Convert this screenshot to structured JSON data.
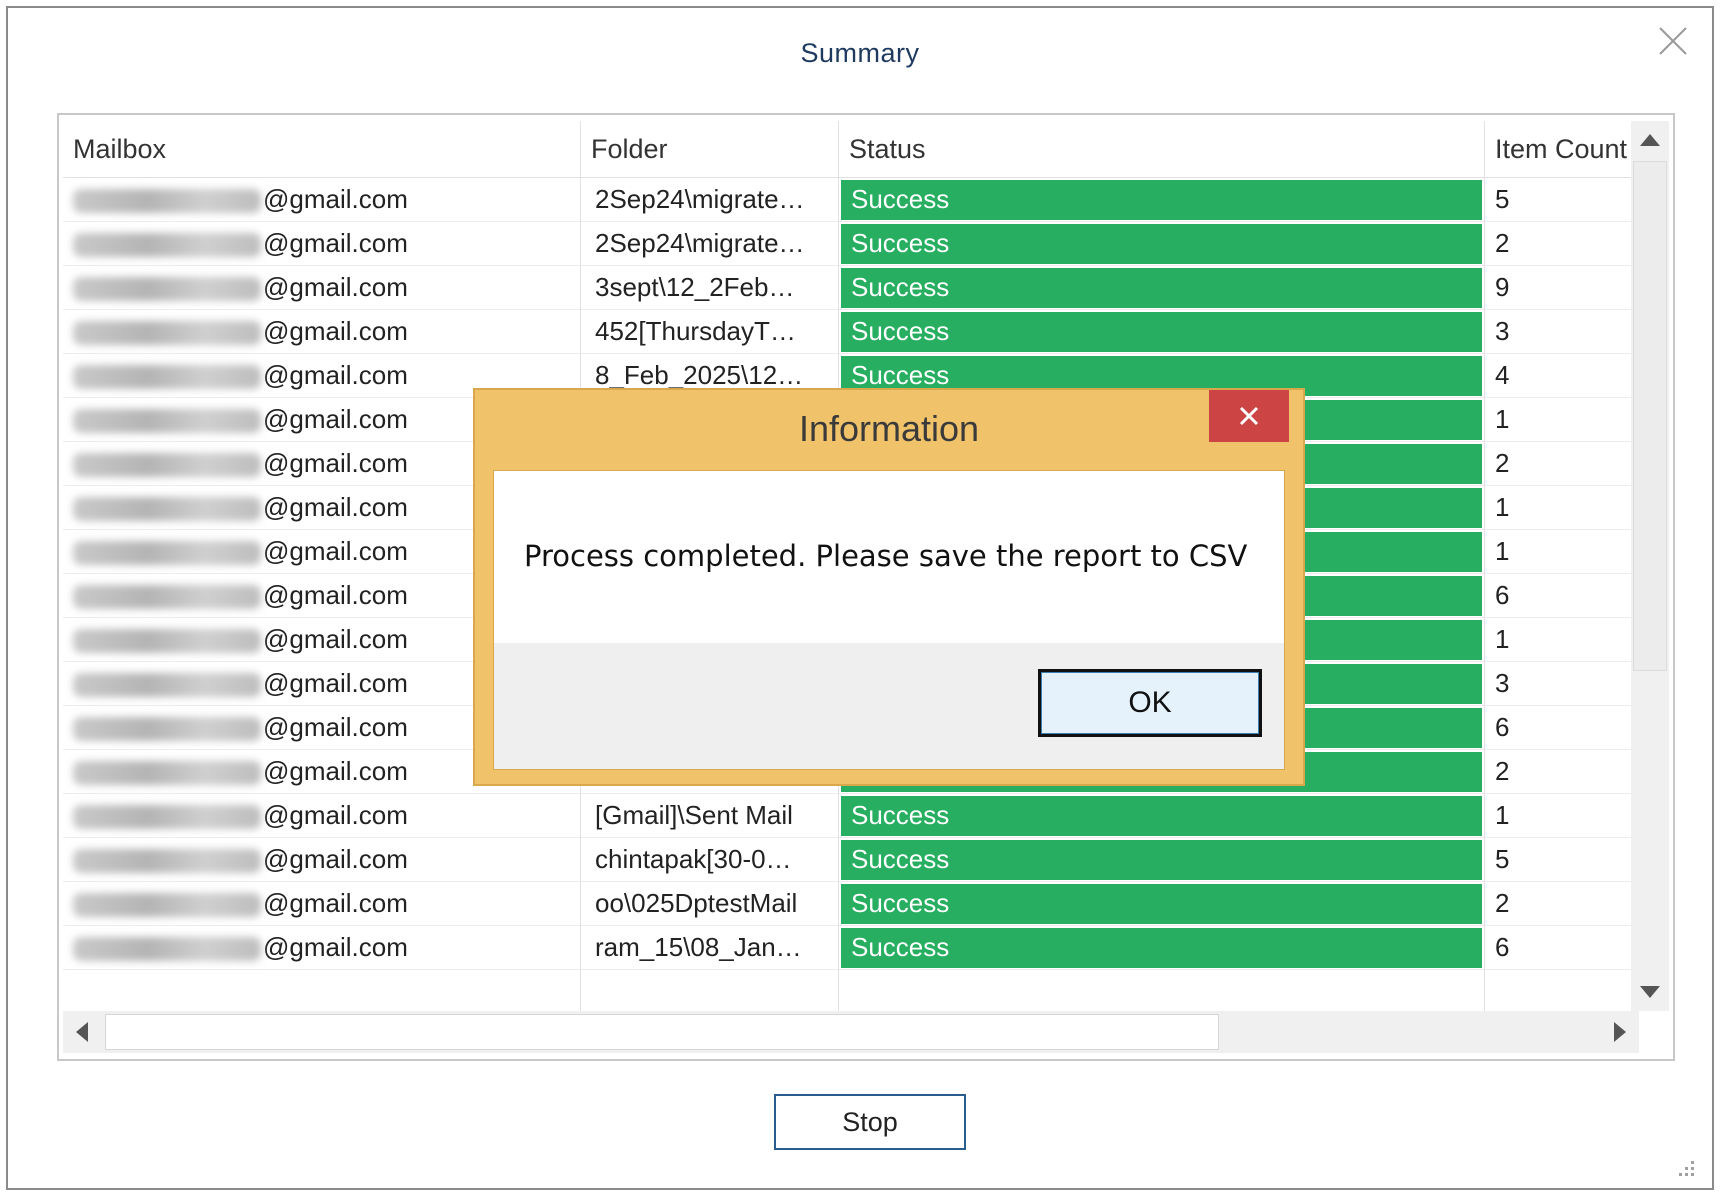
{
  "window": {
    "title": "Summary"
  },
  "grid": {
    "columns": [
      "Mailbox",
      "Folder",
      "Status",
      "Item Count"
    ],
    "rows": [
      {
        "mailbox": "@gmail.com",
        "folder": "2Sep24\\migrate…",
        "status": "Success",
        "count": "5"
      },
      {
        "mailbox": "@gmail.com",
        "folder": "2Sep24\\migrate…",
        "status": "Success",
        "count": "2"
      },
      {
        "mailbox": "@gmail.com",
        "folder": "3sept\\12_2Feb…",
        "status": "Success",
        "count": "9"
      },
      {
        "mailbox": "@gmail.com",
        "folder": "452[ThursdayT…",
        "status": "Success",
        "count": "3"
      },
      {
        "mailbox": "@gmail.com",
        "folder": "8_Feb_2025\\12…",
        "status": "Success",
        "count": "4"
      },
      {
        "mailbox": "@gmail.com",
        "folder": "",
        "status": "",
        "count": "1"
      },
      {
        "mailbox": "@gmail.com",
        "folder": "",
        "status": "",
        "count": "2"
      },
      {
        "mailbox": "@gmail.com",
        "folder": "",
        "status": "",
        "count": "1"
      },
      {
        "mailbox": "@gmail.com",
        "folder": "",
        "status": "",
        "count": "1"
      },
      {
        "mailbox": "@gmail.com",
        "folder": "",
        "status": "",
        "count": "6"
      },
      {
        "mailbox": "@gmail.com",
        "folder": "",
        "status": "",
        "count": "1"
      },
      {
        "mailbox": "@gmail.com",
        "folder": "",
        "status": "",
        "count": "3"
      },
      {
        "mailbox": "@gmail.com",
        "folder": "",
        "status": "",
        "count": "6"
      },
      {
        "mailbox": "@gmail.com",
        "folder": "",
        "status": "",
        "count": "2"
      },
      {
        "mailbox": "@gmail.com",
        "folder": "[Gmail]\\Sent Mail",
        "status": "Success",
        "count": "1"
      },
      {
        "mailbox": "@gmail.com",
        "folder": "chintapak[30-0…",
        "status": "Success",
        "count": "5"
      },
      {
        "mailbox": "@gmail.com",
        "folder": "oo\\025DptestMail",
        "status": "Success",
        "count": "2"
      },
      {
        "mailbox": "@gmail.com",
        "folder": "ram_15\\08_Jan…",
        "status": "Success",
        "count": "6"
      }
    ]
  },
  "buttons": {
    "stop_label": "Stop"
  },
  "dialog": {
    "title": "Information",
    "message": "Process completed. Please save the report to CSV",
    "ok_label": "OK"
  },
  "colors": {
    "success": "#27ae60",
    "dialog_frame": "#f0c36a",
    "dialog_close": "#cc4444",
    "title_text": "#1f3a5f"
  },
  "icons": {
    "window_close": "close-icon",
    "dialog_close": "close-icon",
    "scroll_up": "arrow-up-icon",
    "scroll_down": "arrow-down-icon",
    "scroll_left": "arrow-left-icon",
    "scroll_right": "arrow-right-icon",
    "resize": "resize-grip-icon"
  }
}
